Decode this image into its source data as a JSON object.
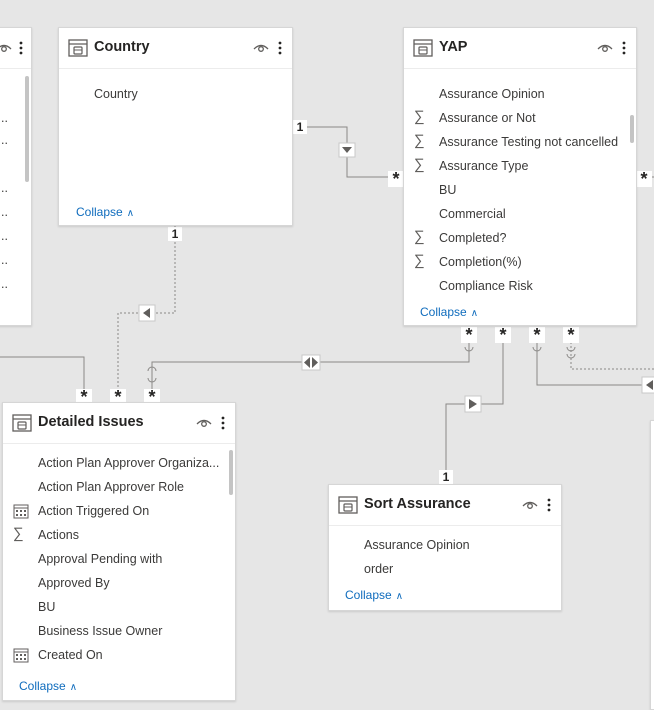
{
  "left_partial": {
    "fields_ellipsis": [
      "..",
      "..",
      "..",
      "..",
      "..",
      "..",
      "..",
      ".."
    ]
  },
  "country": {
    "title": "Country",
    "fields": [
      {
        "label": "Country"
      }
    ],
    "collapse": "Collapse"
  },
  "yap": {
    "title": "YAP",
    "fields": [
      {
        "label": "Assurance Opinion",
        "icon": "none"
      },
      {
        "label": "Assurance or Not",
        "icon": "sigma"
      },
      {
        "label": "Assurance Testing not cancelled",
        "icon": "sigma"
      },
      {
        "label": "Assurance Type",
        "icon": "sigma"
      },
      {
        "label": "BU",
        "icon": "none"
      },
      {
        "label": "Commercial",
        "icon": "none"
      },
      {
        "label": "Completed?",
        "icon": "sigma"
      },
      {
        "label": "Completion(%)",
        "icon": "sigma"
      },
      {
        "label": "Compliance Risk",
        "icon": "none"
      }
    ],
    "collapse": "Collapse"
  },
  "detailed_issues": {
    "title": "Detailed Issues",
    "fields": [
      {
        "label": "Action Plan Approver Organiza...",
        "icon": "none"
      },
      {
        "label": "Action Plan Approver Role",
        "icon": "none"
      },
      {
        "label": "Action Triggered On",
        "icon": "calendar"
      },
      {
        "label": "Actions",
        "icon": "sigma"
      },
      {
        "label": "Approval Pending with",
        "icon": "none"
      },
      {
        "label": "Approved By",
        "icon": "none"
      },
      {
        "label": "BU",
        "icon": "none"
      },
      {
        "label": "Business Issue Owner",
        "icon": "none"
      },
      {
        "label": "Created On",
        "icon": "calendar"
      }
    ],
    "collapse": "Collapse"
  },
  "sort_assurance": {
    "title": "Sort Assurance",
    "fields": [
      {
        "label": "Assurance Opinion"
      },
      {
        "label": "order"
      }
    ],
    "collapse": "Collapse"
  },
  "relationships": {
    "one": "1",
    "many": "*"
  },
  "colors": {
    "canvas": "#e6e6e6",
    "card": "#ffffff",
    "link": "#0f6cbd",
    "line": "#8a8886"
  }
}
